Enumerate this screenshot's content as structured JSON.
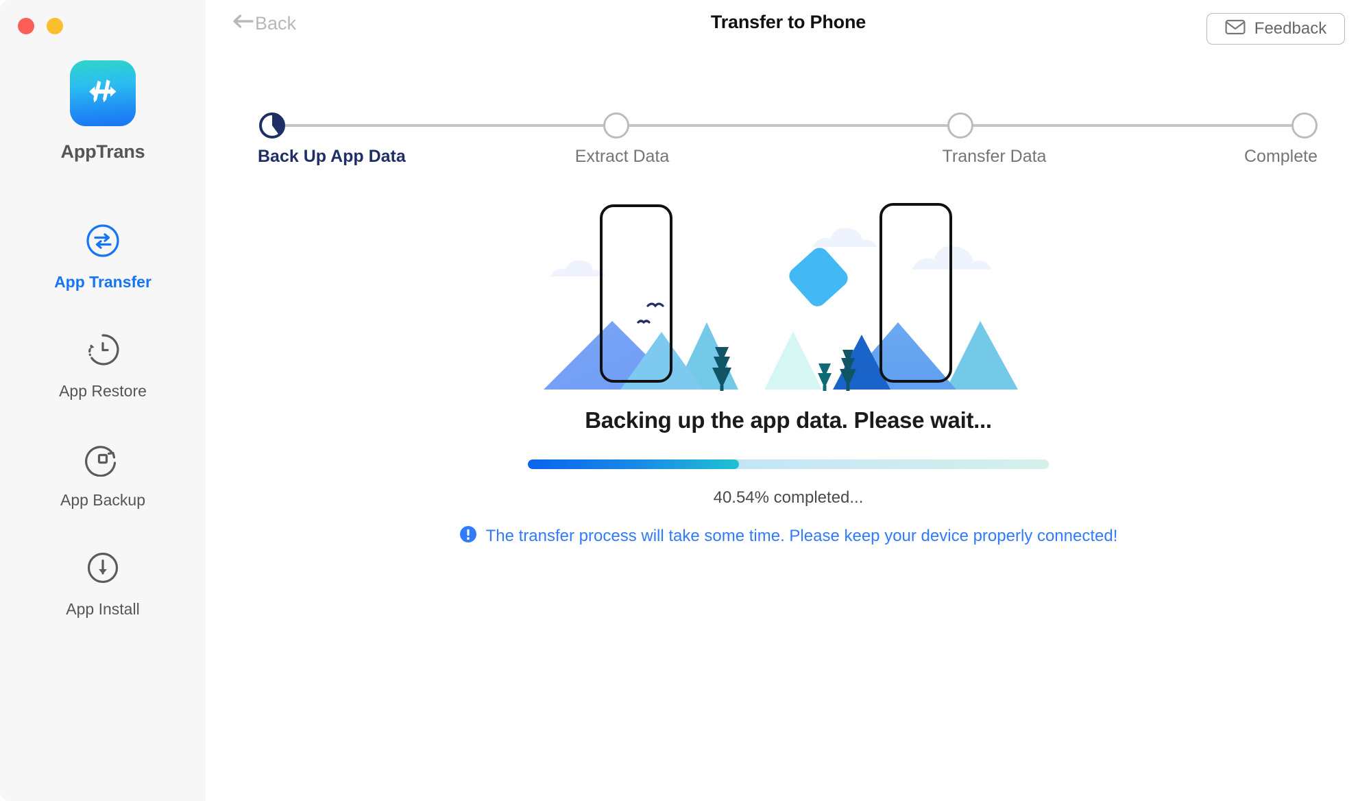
{
  "window": {
    "traffic_lights": [
      {
        "name": "close",
        "color": "#fb5f57"
      },
      {
        "name": "minimize",
        "color": "#fcbe2c"
      }
    ]
  },
  "sidebar": {
    "brand": {
      "name": "AppTrans",
      "logo_icon": "apptrans-logo-icon"
    },
    "items": [
      {
        "label": "App Transfer",
        "icon": "transfer-arrows-icon",
        "active": true
      },
      {
        "label": "App Restore",
        "icon": "clock-restore-icon",
        "active": false
      },
      {
        "label": "App Backup",
        "icon": "backup-square-icon",
        "active": false
      },
      {
        "label": "App Install",
        "icon": "download-arrow-icon",
        "active": false
      }
    ]
  },
  "header": {
    "back_label": "Back",
    "back_icon": "arrow-left-icon",
    "title": "Transfer to Phone",
    "feedback_label": "Feedback",
    "feedback_icon": "envelope-icon"
  },
  "stepper": {
    "steps": [
      {
        "label": "Back Up App Data",
        "state": "active",
        "progress_pct": 40.54
      },
      {
        "label": "Extract Data",
        "state": "pending"
      },
      {
        "label": "Transfer Data",
        "state": "pending"
      },
      {
        "label": "Complete",
        "state": "pending"
      }
    ],
    "active_color": "#1f2f66",
    "pending_color": "#757575"
  },
  "illustration": {
    "name": "two-phones-landscape-illustration",
    "elements": [
      "phone-outline-left",
      "phone-outline-right",
      "mountains",
      "clouds",
      "birds",
      "pine-trees",
      "blue-diamond"
    ],
    "accent_color": "#42b9f5"
  },
  "status": {
    "message": "Backing up the app data. Please wait...",
    "percent_label": "40.54% completed...",
    "progress_value": 40.54,
    "notice_icon": "info-exclamation-icon",
    "notice_text": "The transfer process will take some time. Please keep your device properly connected!",
    "notice_color": "#2f7bfc"
  }
}
